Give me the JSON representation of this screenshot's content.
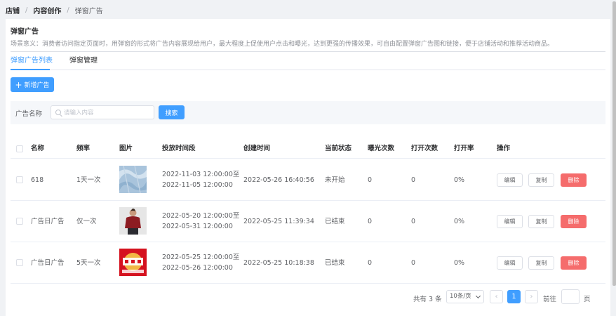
{
  "breadcrumb": [
    "店铺",
    "内容创作",
    "弹窗广告"
  ],
  "page": {
    "title": "弹窗广告",
    "description": "场景意义：消费者访问指定页面时，用弹窗的形式将广告内容展现给用户，最大程度上促使用户点击和曝光，达到更强的传播效果，可自由配置弹窗广告图和链接，便于店铺活动和推荐活动商品。"
  },
  "tabs": [
    {
      "label": "弹窗广告列表",
      "active": true
    },
    {
      "label": "弹窗管理",
      "active": false
    }
  ],
  "toolbar": {
    "add_label": "新增广告"
  },
  "filter": {
    "label": "广告名称",
    "placeholder": "请输入内容",
    "value": "",
    "search_label": "搜索"
  },
  "table": {
    "columns": [
      "名称",
      "频率",
      "图片",
      "投放时间段",
      "创建时间",
      "当前状态",
      "曝光次数",
      "打开次数",
      "打开率",
      "操作"
    ],
    "rows": [
      {
        "name": "618",
        "freq": "1天一次",
        "image": "blue-fabric-thumbnail",
        "start": "2022-11-03 12:00:00至",
        "end": "2022-11-05 12:00:00",
        "created": "2022-05-26 16:40:56",
        "status": "未开始",
        "exposure": "0",
        "opens": "0",
        "rate": "0%"
      },
      {
        "name": "广告日广告",
        "freq": "仅一次",
        "image": "man-red-shirt-thumbnail",
        "start": "2022-05-20 12:00:00至",
        "end": "2022-05-31 12:00:00",
        "created": "2022-05-25 11:39:34",
        "status": "已结束",
        "exposure": "0",
        "opens": "0",
        "rate": "0%"
      },
      {
        "name": "广告日广告",
        "freq": "5天一次",
        "image": "red-promo-thumbnail",
        "start": "2022-05-25 12:00:00至",
        "end": "2022-05-26 12:00:00",
        "created": "2022-05-25 10:18:38",
        "status": "已结束",
        "exposure": "0",
        "opens": "0",
        "rate": "0%"
      }
    ],
    "actions": {
      "edit": "编辑",
      "copy": "复制",
      "delete": "删除"
    }
  },
  "pagination": {
    "total": "共有 3 条",
    "page_size": "10条/页",
    "current_page": "1",
    "goto_label": "前往",
    "page_suffix": "页",
    "prev_icon": "chevron-left-icon",
    "next_icon": "chevron-right-icon"
  },
  "colors": {
    "primary": "#409eff",
    "danger": "#f56c6c"
  }
}
